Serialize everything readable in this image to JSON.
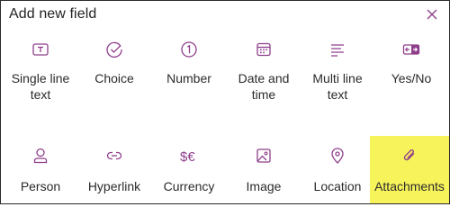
{
  "dialog": {
    "title": "Add new field"
  },
  "colors": {
    "accent": "#8f3f8c",
    "highlight": "#f7f35a"
  },
  "fields": [
    {
      "label_line1": "Single line",
      "label_line2": "text",
      "icon": "text-box-icon"
    },
    {
      "label_line1": "Choice",
      "label_line2": "",
      "icon": "check-circle-icon"
    },
    {
      "label_line1": "Number",
      "label_line2": "",
      "icon": "number-one-icon"
    },
    {
      "label_line1": "Date and",
      "label_line2": "time",
      "icon": "calendar-icon"
    },
    {
      "label_line1": "Multi line",
      "label_line2": "text",
      "icon": "multi-line-text-icon"
    },
    {
      "label_line1": "Yes/No",
      "label_line2": "",
      "icon": "toggle-icon"
    },
    {
      "label_line1": "Person",
      "label_line2": "",
      "icon": "person-icon"
    },
    {
      "label_line1": "Hyperlink",
      "label_line2": "",
      "icon": "link-icon"
    },
    {
      "label_line1": "Currency",
      "label_line2": "",
      "icon": "currency-icon"
    },
    {
      "label_line1": "Image",
      "label_line2": "",
      "icon": "image-icon"
    },
    {
      "label_line1": "Location",
      "label_line2": "",
      "icon": "location-pin-icon"
    },
    {
      "label_line1": "Attachments",
      "label_line2": "",
      "icon": "paperclip-icon"
    }
  ]
}
